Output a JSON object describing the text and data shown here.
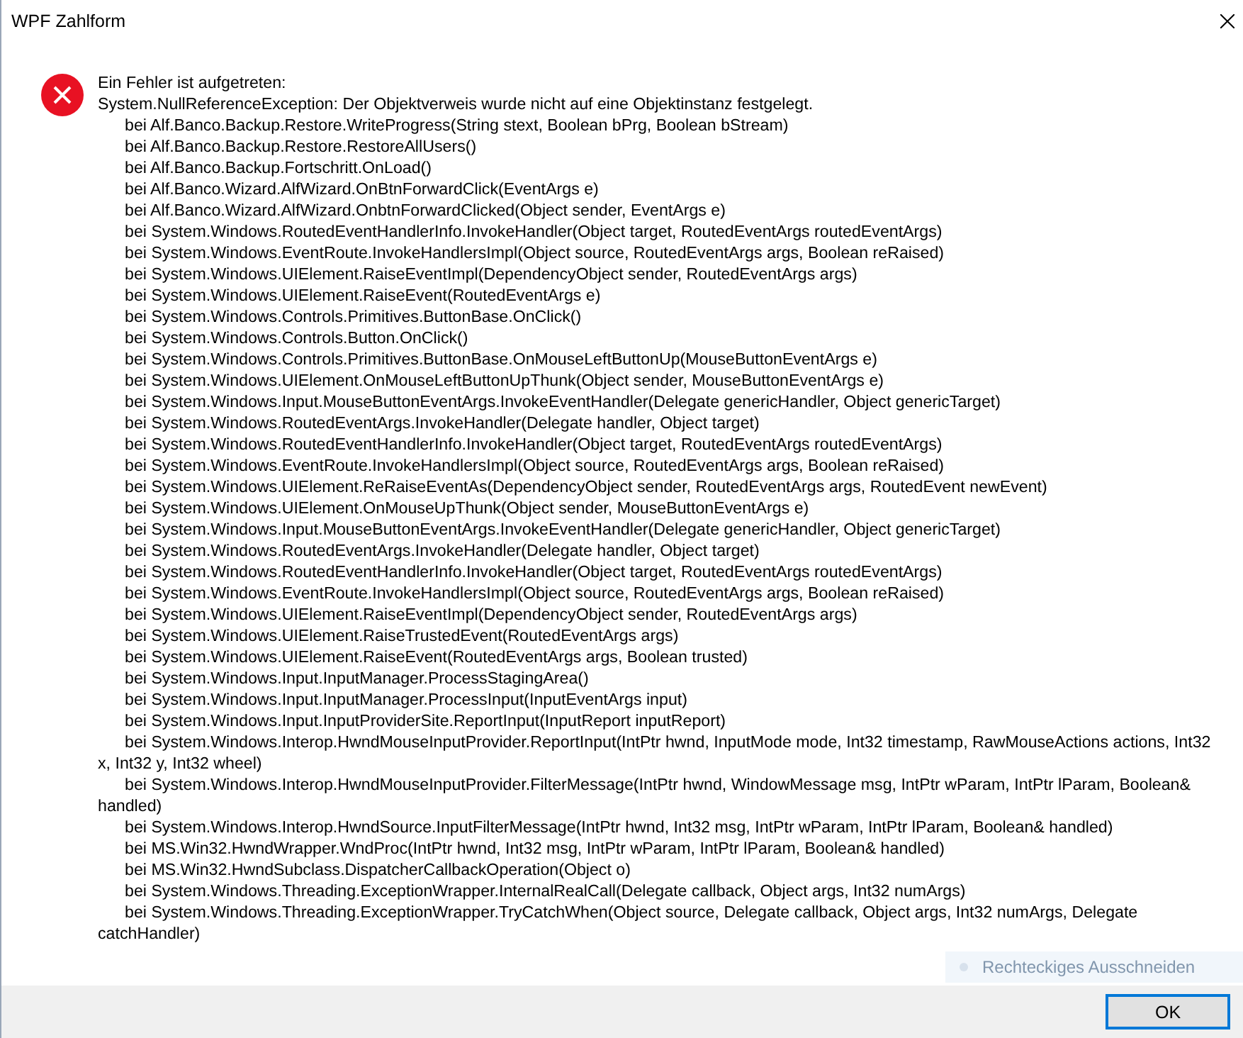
{
  "window": {
    "title": "WPF Zahlform"
  },
  "message": {
    "heading": "Ein Fehler ist aufgetreten:",
    "exception": "System.NullReferenceException: Der Objektverweis wurde nicht auf eine Objektinstanz festgelegt.",
    "stack": [
      "bei Alf.Banco.Backup.Restore.WriteProgress(String stext, Boolean bPrg, Boolean bStream)",
      "bei Alf.Banco.Backup.Restore.RestoreAllUsers()",
      "bei Alf.Banco.Backup.Fortschritt.OnLoad()",
      "bei Alf.Banco.Wizard.AlfWizard.OnBtnForwardClick(EventArgs e)",
      "bei Alf.Banco.Wizard.AlfWizard.OnbtnForwardClicked(Object sender, EventArgs e)",
      "bei System.Windows.RoutedEventHandlerInfo.InvokeHandler(Object target, RoutedEventArgs routedEventArgs)",
      "bei System.Windows.EventRoute.InvokeHandlersImpl(Object source, RoutedEventArgs args, Boolean reRaised)",
      "bei System.Windows.UIElement.RaiseEventImpl(DependencyObject sender, RoutedEventArgs args)",
      "bei System.Windows.UIElement.RaiseEvent(RoutedEventArgs e)",
      "bei System.Windows.Controls.Primitives.ButtonBase.OnClick()",
      "bei System.Windows.Controls.Button.OnClick()",
      "bei System.Windows.Controls.Primitives.ButtonBase.OnMouseLeftButtonUp(MouseButtonEventArgs e)",
      "bei System.Windows.UIElement.OnMouseLeftButtonUpThunk(Object sender, MouseButtonEventArgs e)",
      "bei System.Windows.Input.MouseButtonEventArgs.InvokeEventHandler(Delegate genericHandler, Object genericTarget)",
      "bei System.Windows.RoutedEventArgs.InvokeHandler(Delegate handler, Object target)",
      "bei System.Windows.RoutedEventHandlerInfo.InvokeHandler(Object target, RoutedEventArgs routedEventArgs)",
      "bei System.Windows.EventRoute.InvokeHandlersImpl(Object source, RoutedEventArgs args, Boolean reRaised)",
      "bei System.Windows.UIElement.ReRaiseEventAs(DependencyObject sender, RoutedEventArgs args, RoutedEvent newEvent)",
      "bei System.Windows.UIElement.OnMouseUpThunk(Object sender, MouseButtonEventArgs e)",
      "bei System.Windows.Input.MouseButtonEventArgs.InvokeEventHandler(Delegate genericHandler, Object genericTarget)",
      "bei System.Windows.RoutedEventArgs.InvokeHandler(Delegate handler, Object target)",
      "bei System.Windows.RoutedEventHandlerInfo.InvokeHandler(Object target, RoutedEventArgs routedEventArgs)",
      "bei System.Windows.EventRoute.InvokeHandlersImpl(Object source, RoutedEventArgs args, Boolean reRaised)",
      "bei System.Windows.UIElement.RaiseEventImpl(DependencyObject sender, RoutedEventArgs args)",
      "bei System.Windows.UIElement.RaiseTrustedEvent(RoutedEventArgs args)",
      "bei System.Windows.UIElement.RaiseEvent(RoutedEventArgs args, Boolean trusted)",
      "bei System.Windows.Input.InputManager.ProcessStagingArea()",
      "bei System.Windows.Input.InputManager.ProcessInput(InputEventArgs input)",
      "bei System.Windows.Input.InputProviderSite.ReportInput(InputReport inputReport)",
      "bei System.Windows.Interop.HwndMouseInputProvider.ReportInput(IntPtr hwnd, InputMode mode, Int32 timestamp, RawMouseActions actions, Int32 x, Int32 y, Int32 wheel)",
      "bei System.Windows.Interop.HwndMouseInputProvider.FilterMessage(IntPtr hwnd, WindowMessage msg, IntPtr wParam, IntPtr lParam, Boolean& handled)",
      "bei System.Windows.Interop.HwndSource.InputFilterMessage(IntPtr hwnd, Int32 msg, IntPtr wParam, IntPtr lParam, Boolean& handled)",
      "bei MS.Win32.HwndWrapper.WndProc(IntPtr hwnd, Int32 msg, IntPtr wParam, IntPtr lParam, Boolean& handled)",
      "bei MS.Win32.HwndSubclass.DispatcherCallbackOperation(Object o)",
      "bei System.Windows.Threading.ExceptionWrapper.InternalRealCall(Delegate callback, Object args, Int32 numArgs)",
      "bei System.Windows.Threading.ExceptionWrapper.TryCatchWhen(Object source, Delegate callback, Object args, Int32 numArgs, Delegate catchHandler)"
    ]
  },
  "overlay_tooltip": {
    "text": "Rechteckiges Ausschneiden"
  },
  "buttons": [
    {
      "label": "OK",
      "default": true
    }
  ]
}
